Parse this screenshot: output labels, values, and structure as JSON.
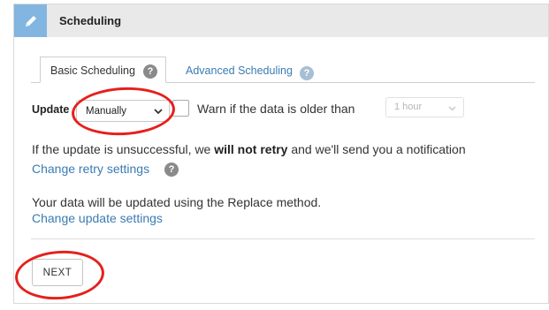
{
  "header": {
    "title": "Scheduling",
    "icon": "pencil-icon",
    "icon_bg": "#82b6e0"
  },
  "tabs": [
    {
      "label": "Basic Scheduling",
      "active": true
    },
    {
      "label": "Advanced Scheduling",
      "active": false
    }
  ],
  "update": {
    "label": "Update",
    "selected": "Manually",
    "warn_checked": false,
    "warn_label": "Warn if the data is older than",
    "age_selected": "1 hour"
  },
  "retry": {
    "text_before": "If the update is unsuccessful, we ",
    "text_bold": "will not retry",
    "text_after": " and we'll send you a notification",
    "link": "Change retry settings"
  },
  "method": {
    "text": "Your data will be updated using the Replace method.",
    "link": "Change update settings"
  },
  "footer": {
    "next_label": "NEXT"
  },
  "colors": {
    "link": "#3a7bb3",
    "help_icon_active": "#8a8a8a",
    "help_icon_inactive": "#a7bfd3",
    "annotation": "#e5201d"
  }
}
